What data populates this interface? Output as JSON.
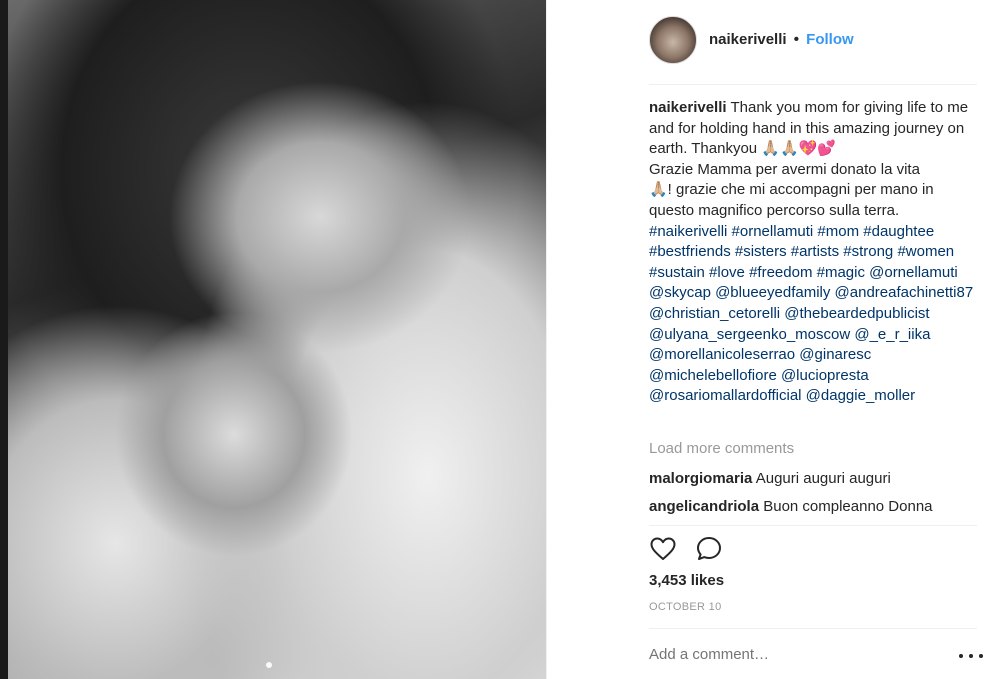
{
  "post": {
    "username": "naikerivelli",
    "separator": "•",
    "follow_label": "Follow"
  },
  "caption": {
    "username": "naikerivelli",
    "text_en": "Thank you mom for giving life to me and for holding hand in this amazing journey on earth. Thankyou 🙏🏼🙏🏼💖💕",
    "text_it_1": "Grazie Mamma per avermi donato la vita",
    "text_it_2": "🙏🏼! grazie che mi accompagni per mano in questo magnifico percorso sulla terra.",
    "tags": "#naikerivelli #ornellamuti #mom #daughtee #bestfriends #sisters #artists #strong #women #sustain #love #freedom #magic @ornellamuti @skycap @blueeyedfamily @andreafachinetti87 @christian_cetorelli @thebeardedpublicist @ulyana_sergeenko_moscow @_e_r_iika @morellanicoleserrao @ginaresc @michelebellofiore @luciopresta @rosariomallardofficial @daggie_moller"
  },
  "load_more_label": "Load more comments",
  "comments": [
    {
      "username": "malorgiomaria",
      "text": "Auguri auguri auguri"
    },
    {
      "username": "angelicandriola",
      "text": "Buon compleanno Donna"
    }
  ],
  "likes": "3,453 likes",
  "date": "OCTOBER 10",
  "add_comment_placeholder": "Add a comment…",
  "icons": {
    "like": "heart-outline-icon",
    "comment": "speech-bubble-icon",
    "more": "more-options-icon"
  }
}
